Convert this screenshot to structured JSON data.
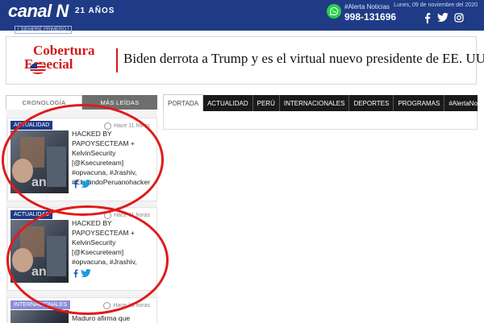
{
  "header": {
    "logo": "canal N",
    "logo_tagline": "[ SIEMPRE PRIMERO ]",
    "years": "21 AÑOS",
    "alerta_label": "#Alerta Noticias",
    "alerta_number": "998-131696",
    "date": "Lunes, 09 de noviembre del 2020",
    "icons": [
      "whatsapp-icon",
      "facebook-icon",
      "twitter-icon",
      "instagram-icon"
    ]
  },
  "banner": {
    "label_line1": "Cobertura",
    "label_line2": "Especial",
    "headline": "Biden derrota a Trump y es el virtual nuevo presidente de EE. UU. »"
  },
  "left_tabs": [
    "CRONOLOGÍA",
    "MÁS LEÍDAS"
  ],
  "cards": [
    {
      "badge": "ACTUALIDAD",
      "time": "Hace 11 horas",
      "text": "HACKED BY PAPOYSECTEAM + KelvinSecurity [@Ksecureteam] #opvacuna, #Jrashiv, #ElmundoPeruanohacker",
      "badge_color": "#1f3b86"
    },
    {
      "badge": "ACTUALIDAD",
      "time": "Hace 11 horas",
      "text": "HACKED BY PAPOYSECTEAM + KelvinSecurity [@Ksecureteam] #opvacuna, #Jrashiv,",
      "badge_color": "#1f3b86"
    },
    {
      "badge": "INTERNACIONALES",
      "time": "Hace 19 horas",
      "text": "Maduro afirma que",
      "badge_color": "#8a8fd6"
    }
  ],
  "right_nav": [
    "PORTADA",
    "ACTUALIDAD",
    "PERÚ",
    "INTERNACIONALES",
    "DEPORTES",
    "PROGRAMAS",
    "#AlertaNoticias"
  ],
  "colors": {
    "header_bg": "#1f3b86",
    "accent_red": "#d21a1a",
    "annotation_red": "#e01b1b"
  }
}
